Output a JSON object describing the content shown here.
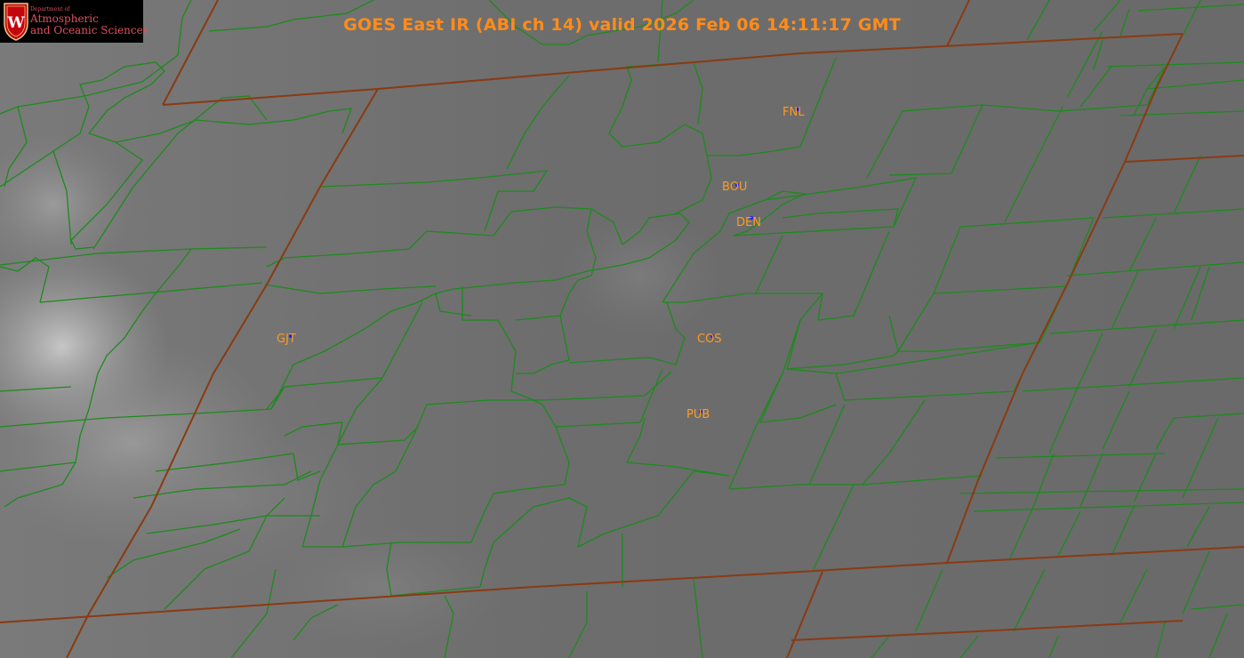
{
  "title": "GOES East IR (ABI ch 14) valid 2026 Feb 06 14:11:17 GMT",
  "logo": {
    "line1": "Department of",
    "line2": "Atmospheric",
    "line3": "and Oceanic Sciences",
    "crest_letter": "W"
  },
  "stations": [
    {
      "code": "FNL"
    },
    {
      "code": "BOU"
    },
    {
      "code": "DEN"
    },
    {
      "code": "GJT"
    },
    {
      "code": "COS"
    },
    {
      "code": "PUB"
    }
  ],
  "colors": {
    "title": "#ff8c1a",
    "station_label": "#ff9a22",
    "station_marker": "#1a1aff",
    "county_border": "#1d8a1d",
    "state_border": "#8a3a12",
    "logo_text": "#e0505a",
    "logo_background": "#000000"
  }
}
